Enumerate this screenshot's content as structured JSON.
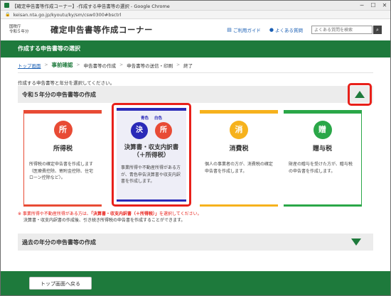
{
  "browser": {
    "title": "【確定申告書等作成コーナー】-作成する申告書等の選択 - Google Chrome",
    "url": "keisan.nta.go.jp/kyoutu/ky/sm/csw0300#bsctrl"
  },
  "header": {
    "agency_line1": "国税庁",
    "agency_line2": "令和５年分",
    "site_title": "確定申告書等作成コーナー",
    "guide_link": "ご利用ガイド",
    "faq_link": "よくある質問",
    "search_placeholder": "よくある質問を検索"
  },
  "page_title": "作成する申告書等の選択",
  "breadcrumb": {
    "items": [
      "トップ画面",
      "事前確認",
      "申告書等の作成",
      "申告書等の送信・印刷",
      "終了"
    ]
  },
  "instruction": "作成する申告書等と年分を選択してください。",
  "current_year_section": {
    "title": "令和５年分の申告書等の作成"
  },
  "cards": {
    "income": {
      "badge": "所",
      "name": "所得税",
      "desc": "所得税の確定申告書を作成します（医療費控除、寄附金控除、住宅ローン控除など）。"
    },
    "kessan": {
      "label_blue": "青色",
      "label_white": "白色",
      "badge1": "決",
      "badge2": "所",
      "name_line1": "決算書・収支内訳書",
      "name_line2": "（＋所得税）",
      "desc": "事業所得や不動産所得がある方が、青色申告決算書や収支内訳書を作成します。"
    },
    "consumption": {
      "badge": "消",
      "name": "消費税",
      "desc": "個人の事業者の方が、消費税の確定申告書を作成します。"
    },
    "gift": {
      "badge": "贈",
      "name": "贈与税",
      "desc": "財産の贈与を受けた方が、贈与税の申告書を作成します。"
    }
  },
  "notes": {
    "line1_prefix": "※ 事業所得や不動産所得がある方は、",
    "line1_emph": "「決算書・収支内訳書（＋所得税）」",
    "line1_suffix": "を選択してください。",
    "line2": "決算書・収支内訳書の作成後、引き続き所得税の申告書を作成することができます。"
  },
  "past_year_section": {
    "title": "過去の年分の申告書等の作成"
  },
  "footer": {
    "back_button": "トップ画面へ戻る"
  },
  "colors": {
    "brand_green": "#1e7a3c",
    "highlight_red": "#e8201a",
    "income_red": "#e84b35",
    "kessan_blue": "#2a2ab8",
    "consumption_yellow": "#f6b21d",
    "gift_green": "#2aa748"
  },
  "icons": {
    "guide": "book-icon",
    "faq": "person-question-icon",
    "search": "search-icon",
    "collapse": "triangle-up-icon",
    "expand": "triangle-down-icon"
  }
}
